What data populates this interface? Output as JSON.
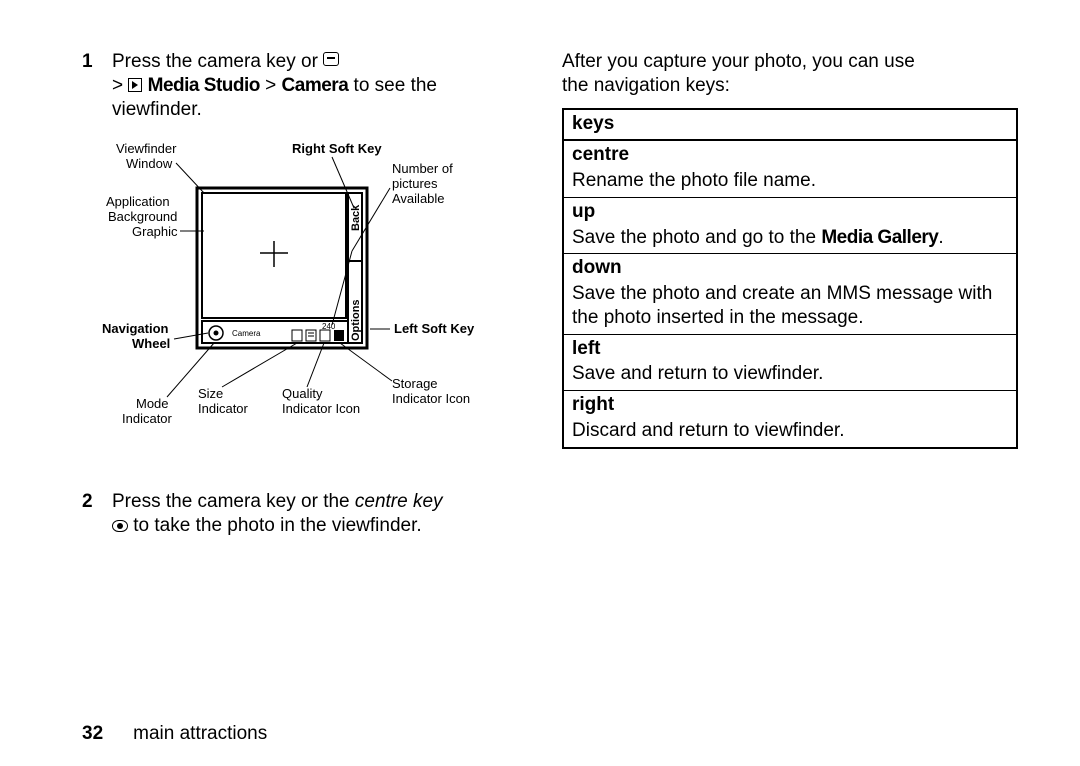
{
  "steps": {
    "s1": {
      "num": "1",
      "l1a": "Press the camera key or ",
      "l2a": " > ",
      "l2b": "Media Studio",
      "l2c": " > ",
      "l2d": "Camera",
      "l2e": " to see the",
      "l3": "viewfinder."
    },
    "s2": {
      "num": "2",
      "l1a": "Press the camera key or the ",
      "l1b": "centre key",
      "l2": " to take the photo in the viewfinder."
    }
  },
  "right": {
    "intro1": "After you capture your photo, you can use",
    "intro2": "the navigation keys:"
  },
  "table": {
    "header": "keys",
    "rows": [
      {
        "key": "centre",
        "desc": "Rename the photo file name."
      },
      {
        "key": "up",
        "desc_pre": "Save the photo and go to the ",
        "desc_bold": "Media Gallery",
        "desc_post": "."
      },
      {
        "key": "down",
        "desc": "Save the photo and create an MMS message with the photo inserted in the message."
      },
      {
        "key": "left",
        "desc": "Save and return to viewfinder."
      },
      {
        "key": "right",
        "desc": "Discard and return to viewfinder."
      }
    ]
  },
  "figure": {
    "viewfinder_window1": "Viewfinder",
    "viewfinder_window2": "Window",
    "app_bg1": "Application",
    "app_bg2": "Background",
    "app_bg3": "Graphic",
    "nav1": "Navigation",
    "nav2": "Wheel",
    "mode1": "Mode",
    "mode2": "Indicator",
    "size1": "Size",
    "size2": "Indicator",
    "quality1": "Quality",
    "quality2": "Indicator Icon",
    "storage1": "Storage",
    "storage2": "Indicator Icon",
    "rsk": "Right Soft Key",
    "lsk": "Left Soft Key",
    "num1": "Number of",
    "num2": "pictures",
    "num3": "Available",
    "back": "Back",
    "options": "Options",
    "camera": "Camera",
    "count": "240"
  },
  "footer": {
    "page": "32",
    "section": "main attractions"
  }
}
